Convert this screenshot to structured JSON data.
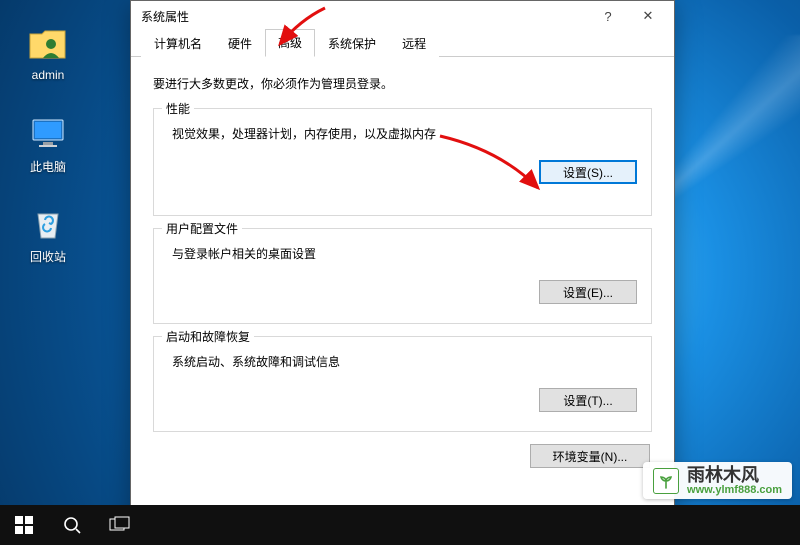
{
  "desktop": {
    "icons": {
      "admin": "admin",
      "pc": "此电脑",
      "recycle": "回收站"
    }
  },
  "dialog": {
    "title": "系统属性",
    "tabs": {
      "computer_name": "计算机名",
      "hardware": "硬件",
      "advanced": "高级",
      "system_protection": "系统保护",
      "remote": "远程"
    },
    "intro": "要进行大多数更改，你必须作为管理员登录。",
    "groups": {
      "performance": {
        "legend": "性能",
        "desc": "视觉效果，处理器计划，内存使用，以及虚拟内存",
        "button": "设置(S)..."
      },
      "user_profiles": {
        "legend": "用户配置文件",
        "desc": "与登录帐户相关的桌面设置",
        "button": "设置(E)..."
      },
      "startup_recovery": {
        "legend": "启动和故障恢复",
        "desc": "系统启动、系统故障和调试信息",
        "button": "设置(T)..."
      }
    },
    "env_button": "环境变量(N)..."
  },
  "watermark": {
    "brand": "雨林木风",
    "url": "www.ylmf888.com"
  }
}
